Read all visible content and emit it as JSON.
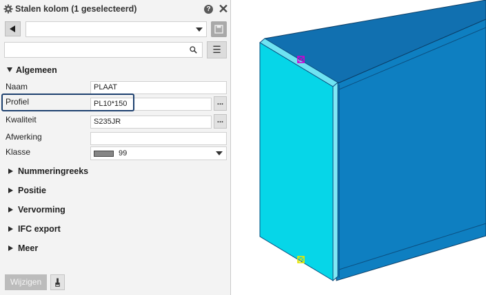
{
  "panel": {
    "title": "Stalen kolom (1 geselecteerd)",
    "help_label": "?",
    "close_label": "✕",
    "settings_value": "",
    "search": {
      "value": "",
      "placeholder": ""
    },
    "menu_icon_glyph": "☰"
  },
  "sections": {
    "algemeen": "Algemeen",
    "nummeringreeks": "Nummeringreeks",
    "positie": "Positie",
    "vervorming": "Vervorming",
    "ifc_export": "IFC export",
    "meer": "Meer"
  },
  "properties": {
    "naam": {
      "label": "Naam",
      "value": "PLAAT"
    },
    "profiel": {
      "label": "Profiel",
      "value": "PL10*150",
      "button": "..."
    },
    "kwaliteit": {
      "label": "Kwaliteit",
      "value": "S235JR",
      "button": "..."
    },
    "afwerking": {
      "label": "Afwerking",
      "value": ""
    },
    "klasse": {
      "label": "Klasse",
      "value": "99"
    }
  },
  "footer": {
    "modify_label": "Wijzigen"
  },
  "colors": {
    "highlight_border": "#1c3f6e",
    "plate_face": "#06d6e8",
    "beam_side": "#0e7fc1",
    "beam_top": "#1170b0",
    "handle_top": "#d100d1",
    "handle_bottom": "#e6e600"
  },
  "icons": [
    "gear-icon",
    "help-icon",
    "close-icon",
    "back-arrow-icon",
    "save-icon",
    "search-icon",
    "menu-icon",
    "pick-icon"
  ]
}
